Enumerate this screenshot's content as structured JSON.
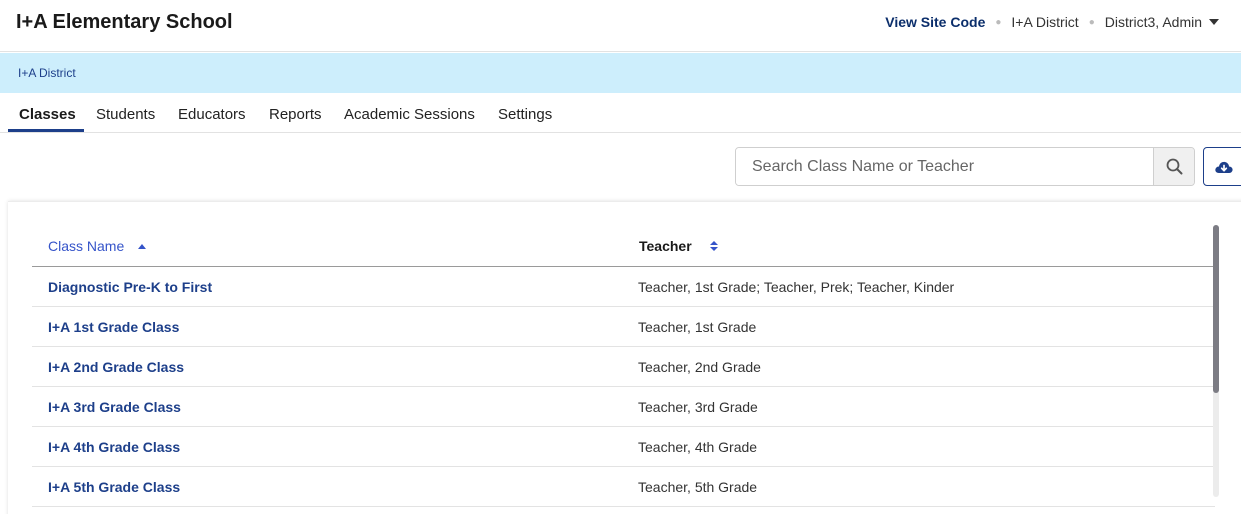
{
  "header": {
    "school_title": "I+A Elementary School",
    "site_code_link": "View Site Code",
    "district": "I+A District",
    "user": "District3, Admin"
  },
  "breadcrumb": {
    "district": "I+A District"
  },
  "tabs": [
    {
      "label": "Classes",
      "active": true
    },
    {
      "label": "Students",
      "active": false
    },
    {
      "label": "Educators",
      "active": false
    },
    {
      "label": "Reports",
      "active": false
    },
    {
      "label": "Academic Sessions",
      "active": false
    },
    {
      "label": "Settings",
      "active": false
    }
  ],
  "search": {
    "placeholder": "Search Class Name or Teacher",
    "value": ""
  },
  "table": {
    "columns": {
      "class_name": "Class Name",
      "teacher": "Teacher"
    },
    "sort": {
      "column": "class_name",
      "direction": "ascending"
    },
    "rows": [
      {
        "class_name": "Diagnostic Pre-K to First",
        "teacher": "Teacher, 1st Grade; Teacher, Prek; Teacher, Kinder"
      },
      {
        "class_name": "I+A 1st Grade Class",
        "teacher": "Teacher, 1st Grade"
      },
      {
        "class_name": "I+A 2nd Grade Class",
        "teacher": "Teacher, 2nd Grade"
      },
      {
        "class_name": "I+A 3rd Grade Class",
        "teacher": "Teacher, 3rd Grade"
      },
      {
        "class_name": "I+A 4th Grade Class",
        "teacher": "Teacher, 4th Grade"
      },
      {
        "class_name": "I+A 5th Grade Class",
        "teacher": "Teacher, 5th Grade"
      }
    ]
  },
  "icons": {
    "search": "search-icon",
    "download": "cloud-download-icon",
    "user_menu": "caret-down-icon",
    "sort_name": "sort-ascending-icon",
    "sort_teacher": "sort-both-icon"
  },
  "colors": {
    "brand": "#1d3f8a",
    "link": "#3554c9",
    "banner": "#cdeefc"
  }
}
